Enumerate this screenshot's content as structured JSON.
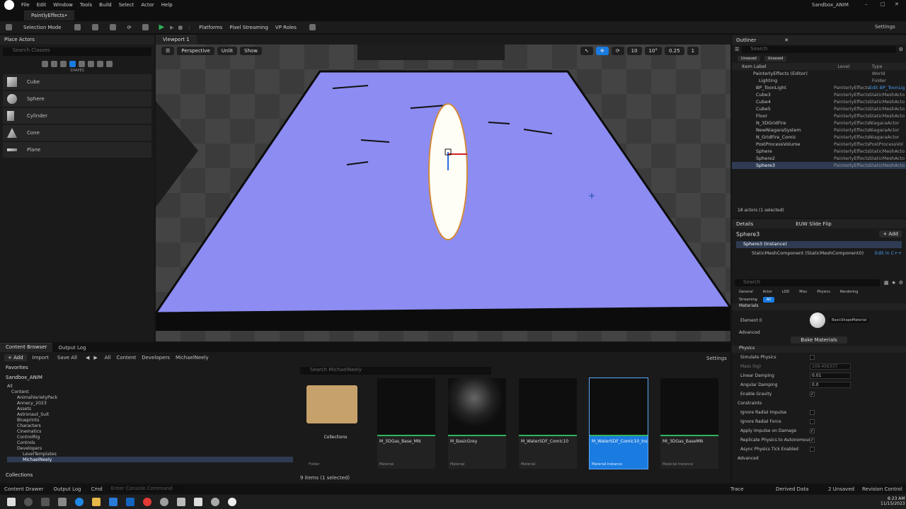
{
  "window": {
    "project": "Sandbox_ANIM",
    "doc_tab": "PaintlyEffects•"
  },
  "menu": [
    "File",
    "Edit",
    "Window",
    "Tools",
    "Build",
    "Select",
    "Actor",
    "Help"
  ],
  "toolbar": {
    "selection_mode": "Selection Mode",
    "platforms": "Platforms",
    "pixel_streaming": "Pixel Streaming",
    "vp_roles": "VP Roles",
    "settings": "Settings"
  },
  "place_actors": {
    "title": "Place Actors",
    "search_placeholder": "Search Classes",
    "section": "SHAPES",
    "items": [
      "Cube",
      "Sphere",
      "Cylinder",
      "Cone",
      "Plane"
    ]
  },
  "viewport": {
    "tab": "Viewport 1",
    "perspective": "Perspective",
    "lit": "Unlit",
    "show": "Show",
    "grid": "10",
    "angle": "10°",
    "scale": "0.25",
    "cam": "1"
  },
  "outliner": {
    "title": "Outliner",
    "search_placeholder": "Search",
    "filters": [
      "Unsaved",
      "Unsaved"
    ],
    "columns": {
      "label": "Item Label",
      "level": "Level",
      "type": "Type"
    },
    "rows": [
      {
        "label": "PainterlyEffects (Editor)",
        "level": "",
        "type": "World"
      },
      {
        "label": "Lighting",
        "level": "",
        "type": "Folder"
      },
      {
        "label": "BP_ToonLight",
        "level": "PainterlyEffects",
        "type": "Edit BP_ToonLig"
      },
      {
        "label": "Cube3",
        "level": "PainterlyEffects",
        "type": "StaticMeshActo"
      },
      {
        "label": "Cube4",
        "level": "PainterlyEffects",
        "type": "StaticMeshActo"
      },
      {
        "label": "Cube5",
        "level": "PainterlyEffects",
        "type": "StaticMeshActo"
      },
      {
        "label": "Floor",
        "level": "PainterlyEffects",
        "type": "StaticMeshActo"
      },
      {
        "label": "N_3DGridFire",
        "level": "PainterlyEffects",
        "type": "NiagaraActor"
      },
      {
        "label": "NewNiagaraSystem",
        "level": "PainterlyEffects",
        "type": "NiagaraActor"
      },
      {
        "label": "N_GridFire_Comic",
        "level": "PainterlyEffects",
        "type": "NiagaraActor"
      },
      {
        "label": "PostProcessVolume",
        "level": "PainterlyEffects",
        "type": "PostProcessVol"
      },
      {
        "label": "Sphere",
        "level": "PainterlyEffects",
        "type": "StaticMeshActo"
      },
      {
        "label": "Sphere2",
        "level": "PainterlyEffects",
        "type": "StaticMeshActo"
      },
      {
        "label": "Sphere3",
        "level": "PainterlyEffects",
        "type": "StaticMeshActo"
      }
    ],
    "footer": "18 actors (1 selected)"
  },
  "details": {
    "tabs": [
      "Details",
      "EUW Slide Flip"
    ],
    "actor": "Sphere3",
    "add": "+ Add",
    "instance": "Sphere3 (Instance)",
    "component": "StaticMeshComponent (StaticMeshComponent0)",
    "edit_cpp": "Edit in C++",
    "search_placeholder": "Search",
    "filter_tabs": [
      "General",
      "Actor",
      "LOD",
      "Misc",
      "Physics",
      "Rendering",
      "Streaming",
      "All"
    ],
    "materials_header": "Materials",
    "element0": "Element 0",
    "material_name": "BasicShapeMaterial",
    "advanced": "Advanced",
    "bake": "Bake Materials",
    "physics_header": "Physics",
    "props": [
      {
        "name": "Simulate Physics",
        "value": ""
      },
      {
        "name": "Mass (kg)",
        "value": "109.456337"
      },
      {
        "name": "Linear Damping",
        "value": "0.01"
      },
      {
        "name": "Angular Damping",
        "value": "0.0"
      },
      {
        "name": "Enable Gravity",
        "value": "✓"
      },
      {
        "name": "Constraints",
        "value": ""
      },
      {
        "name": "Ignore Radial Impulse",
        "value": ""
      },
      {
        "name": "Ignore Radial Force",
        "value": ""
      },
      {
        "name": "Apply Impulse on Damage",
        "value": "✓"
      },
      {
        "name": "Replicate Physics to Autonomous Pr...",
        "value": "✓"
      },
      {
        "name": "Async Physics Tick Enabled",
        "value": ""
      },
      {
        "name": "Advanced",
        "value": ""
      }
    ]
  },
  "content_browser": {
    "tabs": [
      "Content Browser",
      "Output Log"
    ],
    "add": "+ Add",
    "import": "Import",
    "save_all": "Save All",
    "path": [
      "All",
      "Content",
      "Developers",
      "MichaelNeely"
    ],
    "settings": "Settings",
    "favorites": "Favorites",
    "root": "Sandbox_ANIM",
    "tree": [
      "All",
      "Content",
      "AnimalVarietyPack",
      "Annecy_2023",
      "Assets",
      "Astronaut_Suit",
      "Blueprints",
      "Characters",
      "Cinematics",
      "ControlRig",
      "Controls",
      "Developers",
      "LevelTemplates",
      "MichaelNeely"
    ],
    "collections": "Collections",
    "search_placeholder": "Search MichaelNeely",
    "assets": [
      {
        "name": "Collections",
        "cls": "Folder"
      },
      {
        "name": "M_3DGas_Base_MN",
        "cls": "Material"
      },
      {
        "name": "M_BasicGrey",
        "cls": "Material"
      },
      {
        "name": "M_WaterSDF_Comic10",
        "cls": "Material"
      },
      {
        "name": "M_WaterSDF_Comic10_Inst",
        "cls": "Material Instance"
      },
      {
        "name": "MI_3DGas_BaseMN",
        "cls": "Material Instance"
      }
    ],
    "footer": "9 items (1 selected)"
  },
  "statusbar": {
    "drawer": "Content Drawer",
    "output": "Output Log",
    "cmd": "Cmd",
    "console": "Enter Console Command",
    "trace": "Trace",
    "derived": "Derived Data",
    "unsaved": "2 Unsaved",
    "revision": "Revision Control"
  },
  "taskbar": {
    "time": "8:23 AM",
    "date": "11/15/2023"
  },
  "colors": {
    "accent": "#1a7be0",
    "water": "#8c8cf2",
    "selected": "#2e3b52"
  }
}
